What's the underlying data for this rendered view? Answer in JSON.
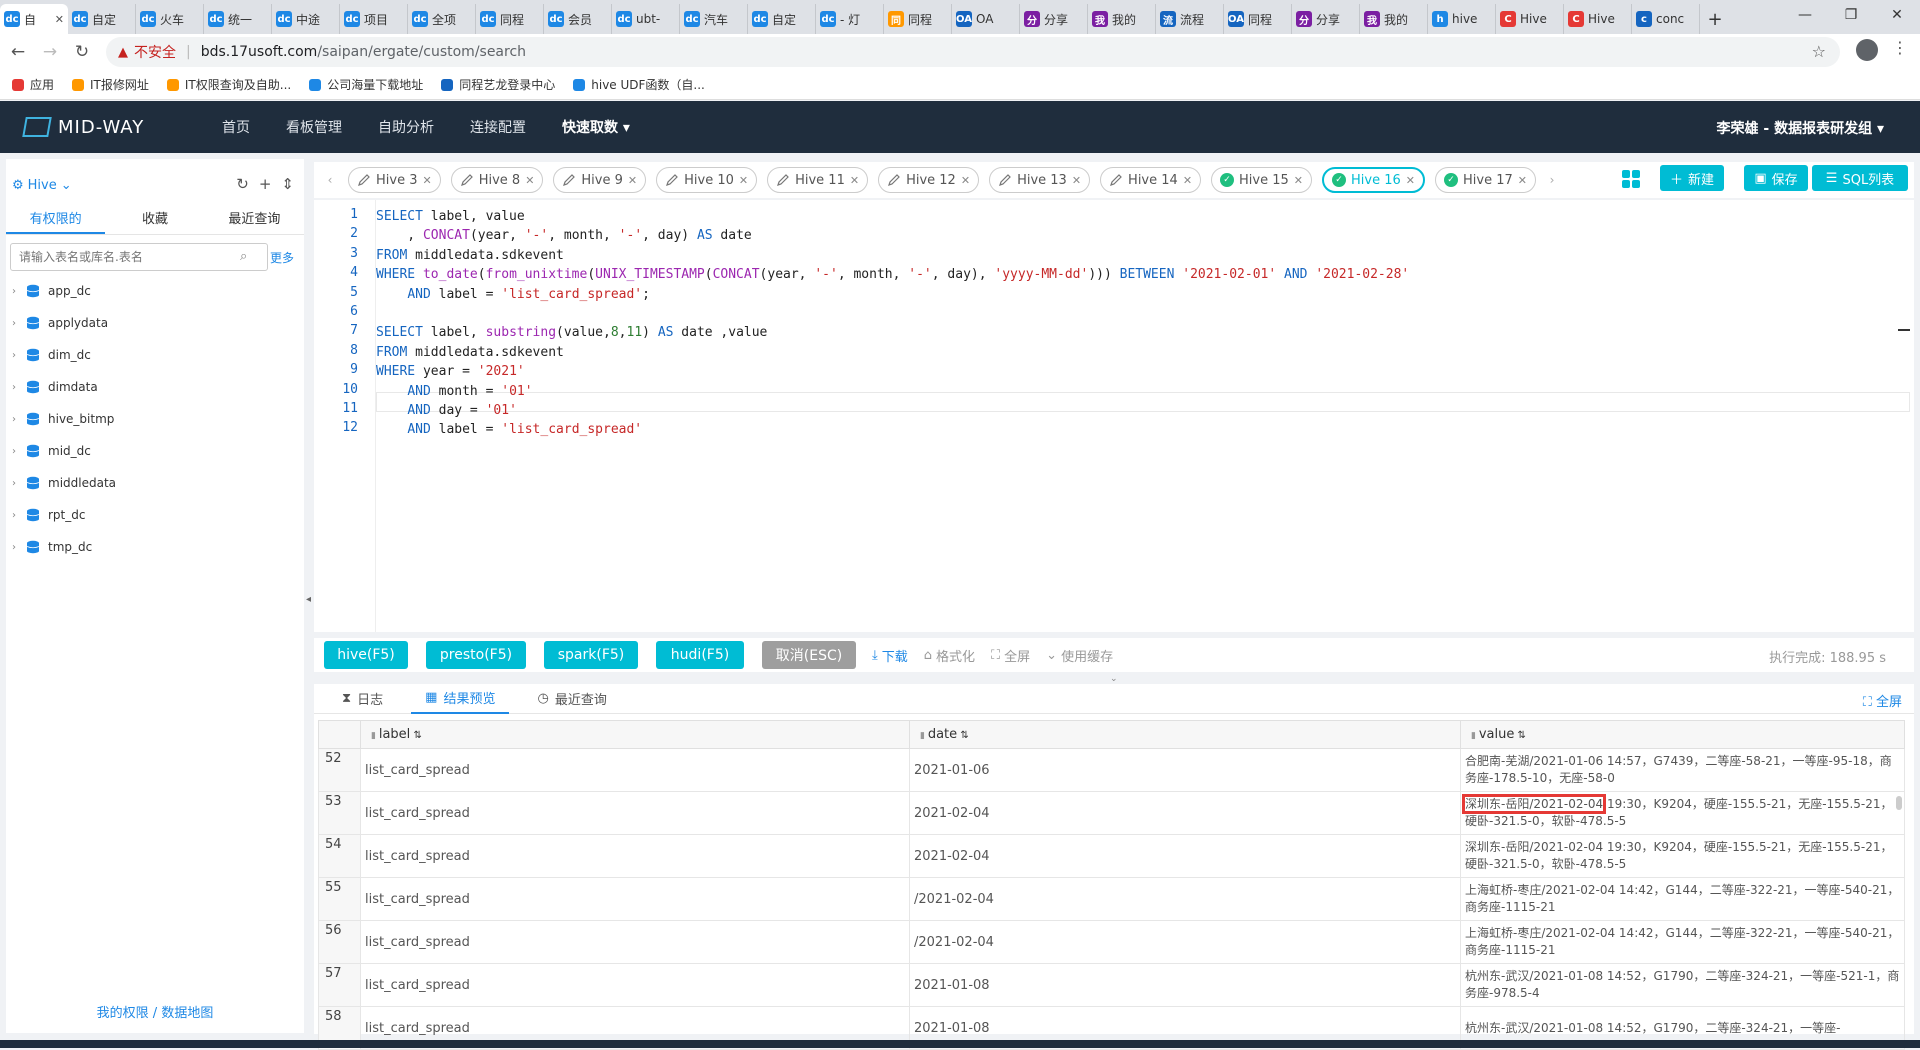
{
  "browser": {
    "tabs": [
      {
        "icon": "dc",
        "label": "自",
        "active": true
      },
      {
        "icon": "dc",
        "label": "自定"
      },
      {
        "icon": "dc",
        "label": "火车"
      },
      {
        "icon": "dc",
        "label": "统一"
      },
      {
        "icon": "dc",
        "label": "中途"
      },
      {
        "icon": "dc",
        "label": "项目"
      },
      {
        "icon": "dc",
        "label": "全项"
      },
      {
        "icon": "dc",
        "label": "同程"
      },
      {
        "icon": "dc",
        "label": "会员"
      },
      {
        "icon": "dc",
        "label": "ubt-"
      },
      {
        "icon": "dc",
        "label": "汽车"
      },
      {
        "icon": "dc",
        "label": "自定"
      },
      {
        "icon": "dc",
        "label": "- 灯"
      },
      {
        "icon": "同",
        "label": "同程"
      },
      {
        "icon": "OA",
        "label": "OA"
      },
      {
        "icon": "分",
        "label": "分享"
      },
      {
        "icon": "我",
        "label": "我的"
      },
      {
        "icon": "流",
        "label": "流程"
      },
      {
        "icon": "OA",
        "label": "同程"
      },
      {
        "icon": "分",
        "label": "分享"
      },
      {
        "icon": "我",
        "label": "我的"
      },
      {
        "icon": "h",
        "label": "hive"
      },
      {
        "icon": "C",
        "label": "Hive"
      },
      {
        "icon": "C",
        "label": "Hive"
      },
      {
        "icon": "c",
        "label": "conc"
      }
    ],
    "close_glyph": "✕",
    "new_tab": "+",
    "window_controls": [
      "—",
      "❐",
      "✕"
    ],
    "nav": {
      "back": "←",
      "forward": "→",
      "reload": "↻"
    },
    "insecure_label": "不安全",
    "url_host": "bds.17usoft.com",
    "url_path": "/saipan/ergate/custom/search",
    "bookmarks": [
      "应用",
      "IT报修网址",
      "IT权限查询及自助...",
      "公司海量下载地址",
      "同程艺龙登录中心",
      "hive UDF函数（自..."
    ]
  },
  "app": {
    "logo_text": "MID-WAY",
    "nav": [
      "首页",
      "看板管理",
      "自助分析",
      "连接配置",
      "快速取数"
    ],
    "user": "李荣雄 - 数据报表研发组"
  },
  "left": {
    "engine": "Hive",
    "tabs": [
      "有权限的",
      "收藏",
      "最近查询"
    ],
    "search_placeholder": "请输入表名或库名.表名",
    "more": "更多",
    "databases": [
      "app_dc",
      "applydata",
      "dim_dc",
      "dimdata",
      "hive_bitmp",
      "mid_dc",
      "middledata",
      "rpt_dc",
      "tmp_dc"
    ],
    "footer": "我的权限 / 数据地图"
  },
  "query_tabs": [
    {
      "label": "Hive 3",
      "status": "edit"
    },
    {
      "label": "Hive 8",
      "status": "edit"
    },
    {
      "label": "Hive 9",
      "status": "edit"
    },
    {
      "label": "Hive 10",
      "status": "edit"
    },
    {
      "label": "Hive 11",
      "status": "edit"
    },
    {
      "label": "Hive 12",
      "status": "edit"
    },
    {
      "label": "Hive 13",
      "status": "edit"
    },
    {
      "label": "Hive 14",
      "status": "edit"
    },
    {
      "label": "Hive 15",
      "status": "done"
    },
    {
      "label": "Hive 16",
      "status": "done",
      "active": true
    },
    {
      "label": "Hive 17",
      "status": "done"
    }
  ],
  "toolbar": {
    "new": "新建",
    "save": "保存",
    "sql_list": "SQL列表"
  },
  "editor": {
    "lines": [
      "SELECT label, value",
      "    , CONCAT(year, '-', month, '-', day) AS date",
      "FROM middledata.sdkevent",
      "WHERE to_date(from_unixtime(UNIX_TIMESTAMP(CONCAT(year, '-', month, '-', day), 'yyyy-MM-dd'))) BETWEEN '2021-02-01' AND '2021-02-28'",
      "    AND label = 'list_card_spread';",
      "",
      "SELECT label, substring(value,8,11) AS date ,value",
      "FROM middledata.sdkevent",
      "WHERE year = '2021'",
      "    AND month = '01'",
      "    AND day = '01'",
      "    AND label = 'list_card_spread'"
    ]
  },
  "run": {
    "buttons": [
      "hive(F5)",
      "presto(F5)",
      "spark(F5)",
      "hudi(F5)",
      "取消(ESC)"
    ],
    "tools": [
      "下载",
      "格式化",
      "全屏",
      "使用缓存"
    ],
    "status": "执行完成: 188.95 s"
  },
  "results": {
    "tabs": [
      "日志",
      "结果预览",
      "最近查询"
    ],
    "fullscreen": "全屏",
    "columns": [
      "label",
      "date",
      "value"
    ],
    "rows": [
      {
        "idx": "52",
        "label": "list_card_spread",
        "date": "2021-01-06",
        "value": "合肥南-芜湖/2021-01-06 14:57，G7439，二等座-58-21，一等座-95-18，商务座-178.5-10，无座-58-0"
      },
      {
        "idx": "53",
        "label": "list_card_spread",
        "date": "2021-02-04",
        "value_hl": "深圳东-岳阳/2021-02-04",
        "value": " 19:30，K9204，硬座-155.5-21，无座-155.5-21，硬卧-321.5-0，软卧-478.5-5"
      },
      {
        "idx": "54",
        "label": "list_card_spread",
        "date": "2021-02-04",
        "value": "深圳东-岳阳/2021-02-04 19:30，K9204，硬座-155.5-21，无座-155.5-21，硬卧-321.5-0，软卧-478.5-5"
      },
      {
        "idx": "55",
        "label": "list_card_spread",
        "date": "/2021-02-04",
        "value": "上海虹桥-枣庄/2021-02-04 14:42，G144，二等座-322-21，一等座-540-21，商务座-1115-21"
      },
      {
        "idx": "56",
        "label": "list_card_spread",
        "date": "/2021-02-04",
        "value": "上海虹桥-枣庄/2021-02-04 14:42，G144，二等座-322-21，一等座-540-21，商务座-1115-21"
      },
      {
        "idx": "57",
        "label": "list_card_spread",
        "date": "2021-01-08",
        "value": "杭州东-武汉/2021-01-08 14:52，G1790，二等座-324-21，一等座-521-1，商务座-978.5-4"
      },
      {
        "idx": "58",
        "label": "list_card_spread",
        "date": "2021-01-08",
        "value": "杭州东-武汉/2021-01-08 14:52，G1790，二等座-324-21，一等座-"
      }
    ]
  }
}
